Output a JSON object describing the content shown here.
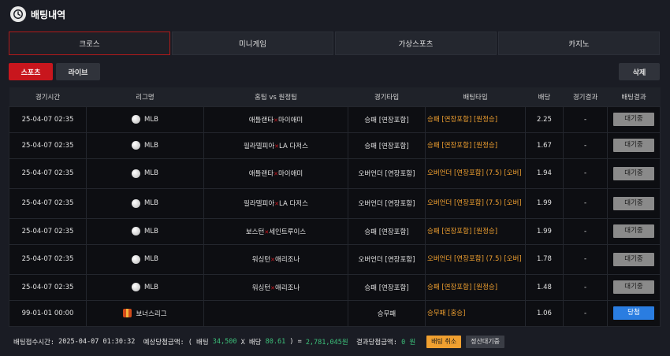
{
  "header": {
    "title": "배팅내역"
  },
  "tabs": [
    "크로스",
    "미니게임",
    "가상스포츠",
    "카지노"
  ],
  "subnav": {
    "sports": "스포츠",
    "live": "라이브",
    "delete": "삭제"
  },
  "columns": [
    "경기시간",
    "리그명",
    "홈팀 vs 원정팀",
    "경기타입",
    "배팅타입",
    "배당",
    "경기결과",
    "배팅결과"
  ],
  "rows": [
    {
      "time": "25-04-07 02:35",
      "league": "MLB",
      "home": "애틀랜타",
      "away": "마이애미",
      "gametype": "승패 [연장포함]",
      "bettype": "승패 [연장포함] [원정승]",
      "odds": "2.25",
      "result": "-",
      "status": "대기중"
    },
    {
      "time": "25-04-07 02:35",
      "league": "MLB",
      "home": "필라델피아",
      "away": "LA 다저스",
      "gametype": "승패 [연장포함]",
      "bettype": "승패 [연장포함] [원정승]",
      "odds": "1.67",
      "result": "-",
      "status": "대기중"
    },
    {
      "time": "25-04-07 02:35",
      "league": "MLB",
      "home": "애틀랜타",
      "away": "마이애미",
      "gametype": "오버언더 [연장포함]",
      "bettype": "오버언더 [연장포함] (7.5) [오버]",
      "odds": "1.94",
      "result": "-",
      "status": "대기중"
    },
    {
      "time": "25-04-07 02:35",
      "league": "MLB",
      "home": "필라델피아",
      "away": "LA 다저스",
      "gametype": "오버언더 [연장포함]",
      "bettype": "오버언더 [연장포함] (7.5) [오버]",
      "odds": "1.99",
      "result": "-",
      "status": "대기중"
    },
    {
      "time": "25-04-07 02:35",
      "league": "MLB",
      "home": "보스턴",
      "away": "세인트루이스",
      "gametype": "승패 [연장포함]",
      "bettype": "승패 [연장포함] [원정승]",
      "odds": "1.99",
      "result": "-",
      "status": "대기중"
    },
    {
      "time": "25-04-07 02:35",
      "league": "MLB",
      "home": "워싱턴",
      "away": "애리조나",
      "gametype": "오버언더 [연장포함]",
      "bettype": "오버언더 [연장포함] (7.5) [오버]",
      "odds": "1.78",
      "result": "-",
      "status": "대기중"
    },
    {
      "time": "25-04-07 02:35",
      "league": "MLB",
      "home": "워싱턴",
      "away": "애리조나",
      "gametype": "승패 [연장포함]",
      "bettype": "승패 [연장포함] [원정승]",
      "odds": "1.48",
      "result": "-",
      "status": "대기중"
    },
    {
      "time": "99-01-01 00:00",
      "league": "보너스리그",
      "home": "",
      "away": "",
      "gametype": "승무패",
      "bettype": "승무패 [홈승]",
      "odds": "1.06",
      "result": "-",
      "status": "당첨"
    }
  ],
  "footer": {
    "received_label": "배팅접수시간: ",
    "received_time": "2025-04-07 01:30:32",
    "expected_label": "  예상당첨금액: ( 배팅 ",
    "bet_amount": "34,500",
    "x_odds_label": " X 배당 ",
    "total_odds": "80.61",
    "equals_label": " ) = ",
    "expected_amount": "2,781,045원",
    "result_label": "  결과당첨금액: ",
    "result_amount": "0 원",
    "cancel_button": "배팅 취소",
    "settle_button": "정산대기중"
  }
}
